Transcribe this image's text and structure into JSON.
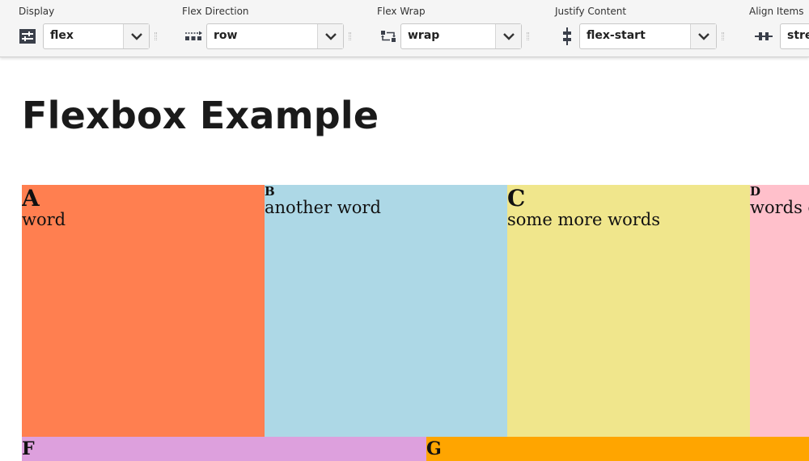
{
  "toolbar": {
    "display": {
      "label": "Display",
      "value": "flex",
      "icon": "display-icon"
    },
    "direction": {
      "label": "Flex Direction",
      "value": "row",
      "icon": "flex-direction-icon"
    },
    "wrap": {
      "label": "Flex Wrap",
      "value": "wrap",
      "icon": "flex-wrap-icon"
    },
    "justify": {
      "label": "Justify Content",
      "value": "flex-start",
      "icon": "justify-content-icon"
    },
    "align": {
      "label": "Align Items",
      "value": "stre",
      "icon": "align-items-icon"
    }
  },
  "page": {
    "title": "Flexbox Example"
  },
  "items": [
    {
      "letter": "A",
      "text": "word",
      "color": "#ff7f50"
    },
    {
      "letter": "B",
      "text": "another word",
      "color": "#add8e6"
    },
    {
      "letter": "C",
      "text": "some more words",
      "color": "#f0e68c"
    },
    {
      "letter": "D",
      "text": "words c",
      "color": "#ffc0cb"
    },
    {
      "letter": "F",
      "text": "",
      "color": "#dda0dd"
    },
    {
      "letter": "G",
      "text": "",
      "color": "#ffa500"
    }
  ]
}
